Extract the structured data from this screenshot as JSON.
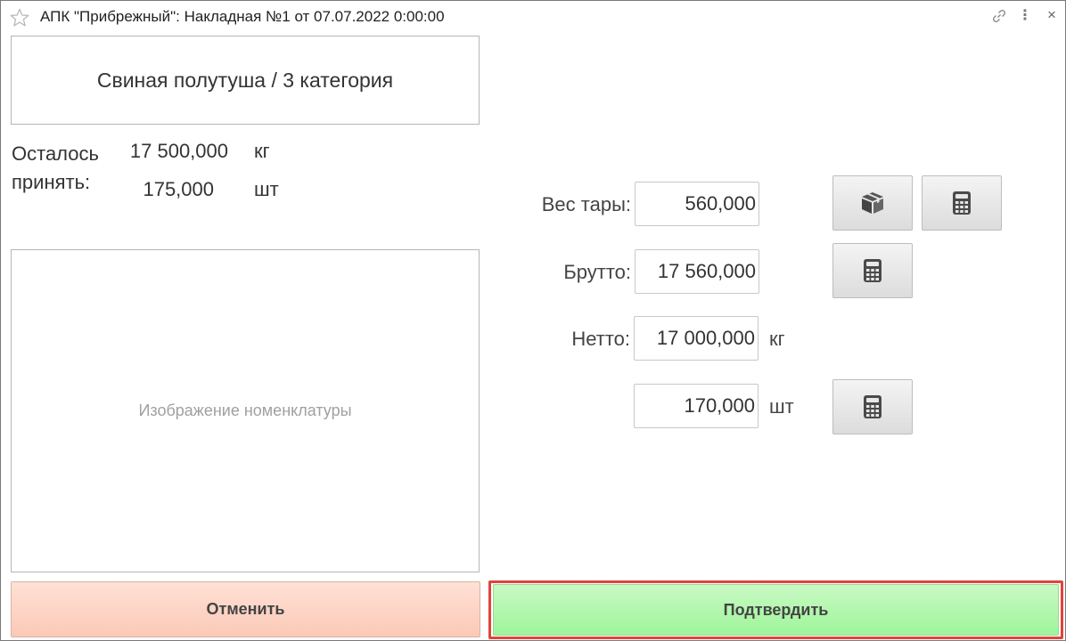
{
  "window": {
    "title": "АПК \"Прибрежный\": Накладная №1 от 07.07.2022 0:00:00",
    "more_label": "⋮",
    "close_label": "×"
  },
  "product": {
    "name": "Свиная полутуша / 3 категория"
  },
  "remaining": {
    "label_line1": "Осталось",
    "label_line2": "принять:",
    "weight_value": "17 500,000",
    "weight_unit": "кг",
    "count_value": "175,000",
    "count_unit": "шт"
  },
  "image_placeholder": "Изображение номенклатуры",
  "form": {
    "tare_label": "Вес тары:",
    "tare_value": "560,000",
    "gross_label": "Брутто:",
    "gross_value": "17 560,000",
    "net_label": "Нетто:",
    "net_value": "17 000,000",
    "net_unit": "кг",
    "count_value": "170,000",
    "count_unit": "шт"
  },
  "buttons": {
    "cancel": "Отменить",
    "confirm": "Подтвердить"
  },
  "icons": {
    "favorite": "star-icon",
    "link": "link-icon",
    "more": "more-vertical-icon",
    "close": "close-icon",
    "package": "package-icon",
    "calculator": "calculator-icon"
  },
  "colors": {
    "cancel_bg": "#fbc9b6",
    "confirm_bg": "#9ef59a",
    "highlight": "#e0443a"
  }
}
